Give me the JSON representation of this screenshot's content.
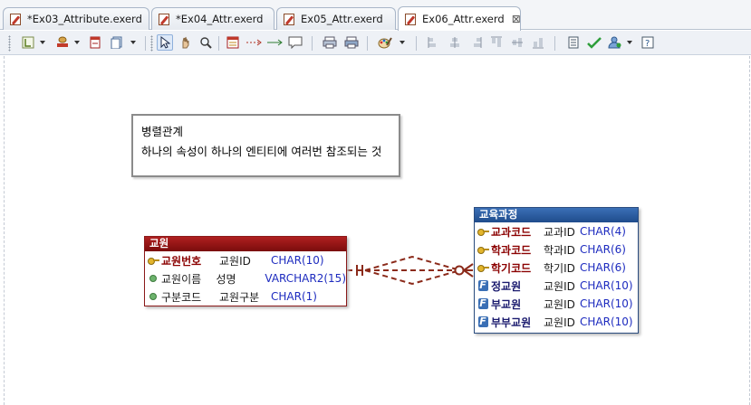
{
  "tabs": [
    {
      "label": "*Ex03_Attribute.exerd",
      "active": false
    },
    {
      "label": "*Ex04_Attr.exerd",
      "active": false
    },
    {
      "label": "Ex05_Attr.exerd",
      "active": false
    },
    {
      "label": "Ex06_Attr.exerd",
      "active": true
    }
  ],
  "close_glyph": "⊠",
  "note": {
    "title": "병렬관계",
    "body": "하나의 속성이 하나의 엔티티에 여러번 참조되는 것"
  },
  "entities": {
    "left": {
      "name": "교원",
      "rows": [
        {
          "kind": "pk",
          "logical": "교원번호",
          "physical": "교원ID",
          "type": "CHAR(10)"
        },
        {
          "kind": "attr",
          "logical": "교원이름",
          "physical": "성명",
          "type": "VARCHAR2(15)"
        },
        {
          "kind": "attr",
          "logical": "구분코드",
          "physical": "교원구분",
          "type": "CHAR(1)"
        }
      ]
    },
    "right": {
      "name": "교육과정",
      "rows": [
        {
          "kind": "pk",
          "logical": "교과코드",
          "physical": "교과ID",
          "type": "CHAR(4)"
        },
        {
          "kind": "pk",
          "logical": "학과코드",
          "physical": "학과ID",
          "type": "CHAR(6)"
        },
        {
          "kind": "pk",
          "logical": "학기코드",
          "physical": "학기ID",
          "type": "CHAR(6)"
        },
        {
          "kind": "fk",
          "logical": "정교원",
          "physical": "교원ID",
          "type": "CHAR(10)"
        },
        {
          "kind": "fk",
          "logical": "부교원",
          "physical": "교원ID",
          "type": "CHAR(10)"
        },
        {
          "kind": "fk",
          "logical": "부부교원",
          "physical": "교원ID",
          "type": "CHAR(10)"
        }
      ]
    }
  },
  "colors": {
    "relationship": "#8b2a1a",
    "left_header": "#9a1414",
    "right_header": "#2f5fa5"
  },
  "icons": {
    "pk": "key-icon",
    "attr": "attribute-dot-icon",
    "fk": "foreign-key-icon"
  }
}
